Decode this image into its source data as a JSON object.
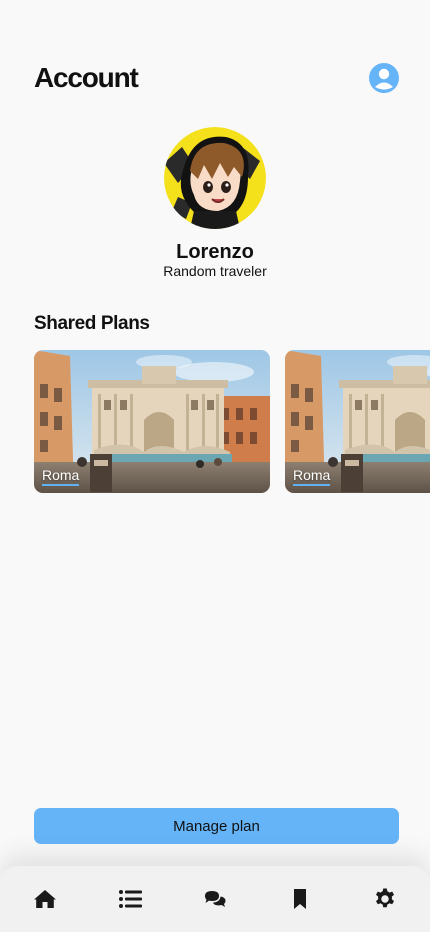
{
  "header": {
    "title": "Account",
    "account_icon": "user-circle-icon"
  },
  "profile": {
    "name": "Lorenzo",
    "subtitle": "Random traveler",
    "avatar_icon": "cartoon-avatar"
  },
  "shared_plans": {
    "title": "Shared Plans",
    "items": [
      {
        "label": "Roma"
      },
      {
        "label": "Roma"
      }
    ]
  },
  "actions": {
    "manage_label": "Manage plan"
  },
  "nav": {
    "items": [
      {
        "icon": "home-icon"
      },
      {
        "icon": "list-icon"
      },
      {
        "icon": "chat-icon"
      },
      {
        "icon": "bookmark-icon"
      },
      {
        "icon": "gear-icon"
      }
    ]
  },
  "colors": {
    "accent": "#66b4f8",
    "label_underline": "#60b0f4",
    "background": "#f9f9f9"
  }
}
